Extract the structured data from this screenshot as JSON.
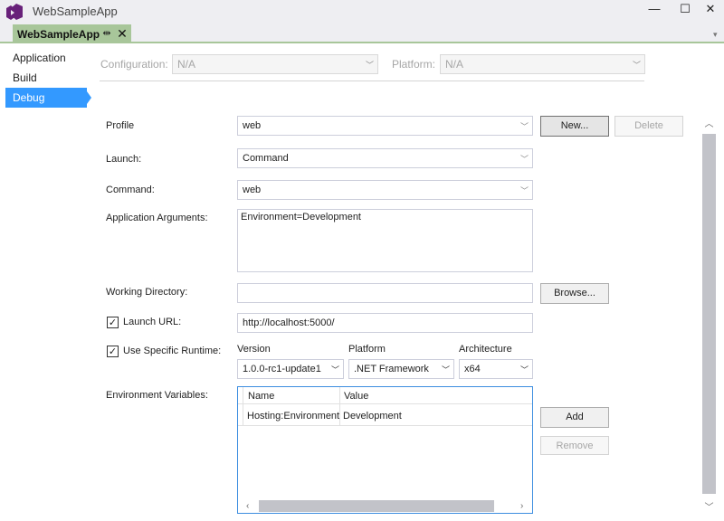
{
  "window": {
    "title": "WebSampleApp",
    "minimize_glyph": "—",
    "maximize_glyph": "☐",
    "close_glyph": "✕"
  },
  "tab": {
    "label": "WebSampleApp",
    "pin_glyph": "⇹",
    "close_glyph": "✕"
  },
  "sidebar": {
    "items": [
      {
        "label": "Application"
      },
      {
        "label": "Build"
      },
      {
        "label": "Debug"
      }
    ]
  },
  "config": {
    "configuration_label": "Configuration:",
    "configuration_value": "N/A",
    "platform_label": "Platform:",
    "platform_value": "N/A"
  },
  "form": {
    "profile_label": "Profile",
    "profile_value": "web",
    "new_button": "New...",
    "delete_button": "Delete",
    "launch_label": "Launch:",
    "launch_value": "Command",
    "command_label": "Command:",
    "command_value": "web",
    "app_args_label": "Application Arguments:",
    "app_args_value": "Environment=Development",
    "working_dir_label": "Working Directory:",
    "working_dir_value": "",
    "browse_button": "Browse...",
    "launch_url_label": "Launch URL:",
    "launch_url_checked": true,
    "launch_url_value": "http://localhost:5000/",
    "runtime_label": "Use Specific Runtime:",
    "runtime_checked": true,
    "version_label": "Version",
    "version_value": "1.0.0-rc1-update1",
    "platform_label": "Platform",
    "platform_value": ".NET Framework",
    "arch_label": "Architecture",
    "arch_value": "x64",
    "env_vars_label": "Environment Variables:",
    "env_table": {
      "headers": [
        "Name",
        "Value"
      ],
      "rows": [
        [
          "Hosting:Environment",
          "Development"
        ]
      ]
    },
    "add_button": "Add",
    "remove_button": "Remove"
  },
  "colors": {
    "accent": "#3399ff",
    "tab": "#a8c69a",
    "grid_border": "#3c8de0"
  }
}
